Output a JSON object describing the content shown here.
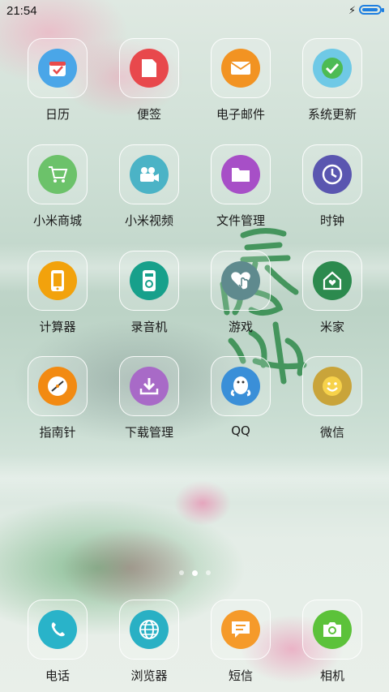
{
  "status_bar": {
    "time": "21:54",
    "charging_icon": "lightning-icon",
    "battery_level": 1.0,
    "battery_color": "#1e7fe0"
  },
  "wallpaper": {
    "calligraphy": "最忆江南"
  },
  "apps": [
    {
      "label": "日历",
      "icon": "calendar-icon",
      "color": "#4aa6e8"
    },
    {
      "label": "便签",
      "icon": "note-icon",
      "color": "#e8484c"
    },
    {
      "label": "电子邮件",
      "icon": "mail-icon",
      "color": "#f29322"
    },
    {
      "label": "系统更新",
      "icon": "check-update-icon",
      "color": "#6fc9e6"
    },
    {
      "label": "小米商城",
      "icon": "cart-icon",
      "color": "#6cc26a"
    },
    {
      "label": "小米视频",
      "icon": "video-camera-icon",
      "color": "#4bb3c6"
    },
    {
      "label": "文件管理",
      "icon": "folder-icon",
      "color": "#a74fc7"
    },
    {
      "label": "时钟",
      "icon": "clock-icon",
      "color": "#5a56b0"
    },
    {
      "label": "计算器",
      "icon": "calculator-icon",
      "color": "#f2a20c"
    },
    {
      "label": "录音机",
      "icon": "recorder-icon",
      "color": "#17a08b"
    },
    {
      "label": "游戏",
      "icon": "game-icon",
      "color": "#5f8a8e"
    },
    {
      "label": "米家",
      "icon": "home-icon",
      "color": "#2c8a4e"
    },
    {
      "label": "指南针",
      "icon": "compass-icon",
      "color": "#f28a12"
    },
    {
      "label": "下载管理",
      "icon": "download-icon",
      "color": "#a86ac7"
    },
    {
      "label": "QQ",
      "icon": "qq-penguin-icon",
      "color": "#3a8fd8"
    },
    {
      "label": "微信",
      "icon": "smiley-icon",
      "color": "#c9a43a"
    }
  ],
  "page_indicator": {
    "count": 3,
    "active_index": 1
  },
  "dock": [
    {
      "label": "电话",
      "icon": "phone-icon",
      "color": "#29b3c9"
    },
    {
      "label": "浏览器",
      "icon": "globe-icon",
      "color": "#29b0c4"
    },
    {
      "label": "短信",
      "icon": "message-icon",
      "color": "#f59a2a"
    },
    {
      "label": "相机",
      "icon": "camera-icon",
      "color": "#5cc23a"
    }
  ]
}
